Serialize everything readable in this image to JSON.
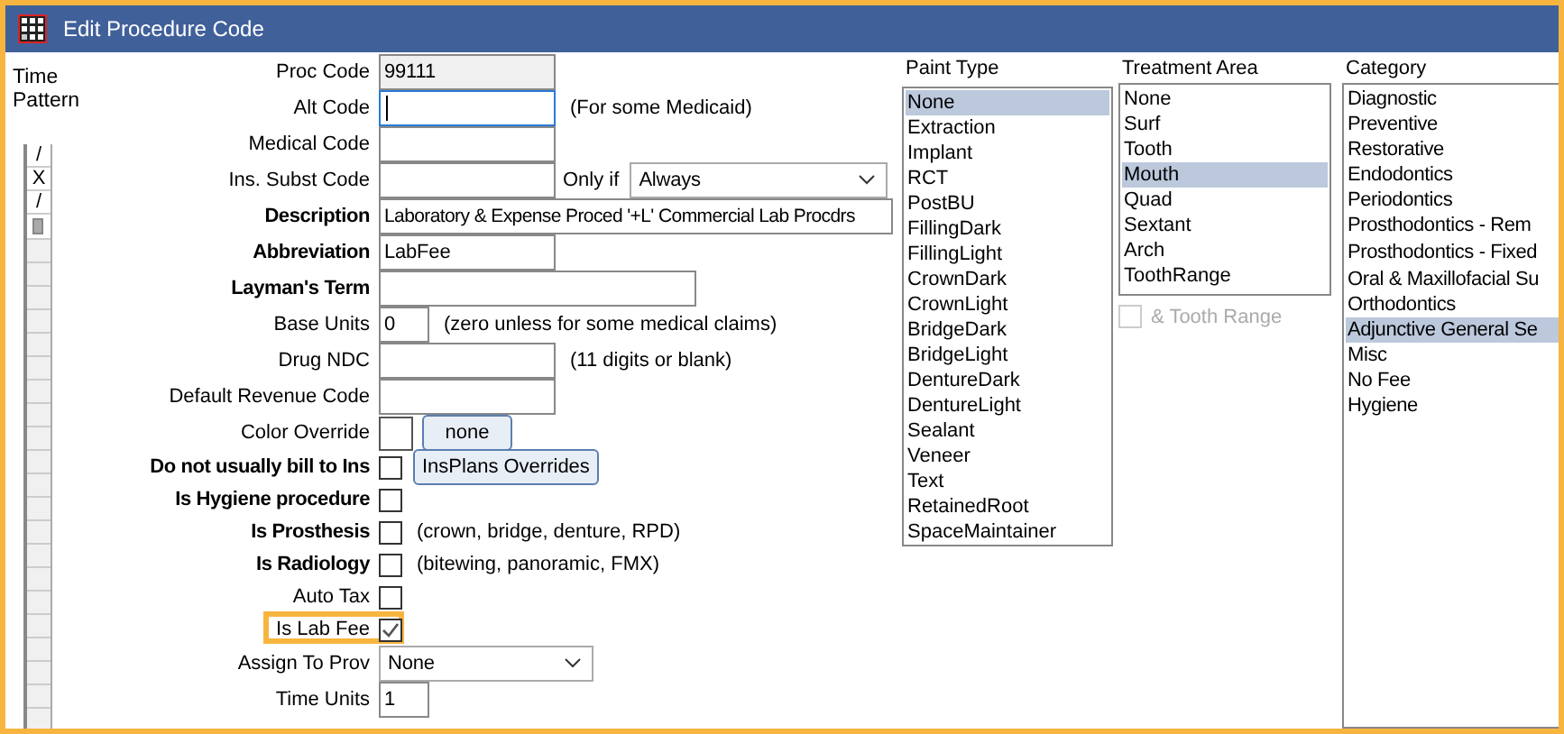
{
  "window": {
    "title": "Edit Procedure Code"
  },
  "time_pattern": {
    "label": "Time Pattern",
    "cells": [
      "/",
      "X",
      "/"
    ]
  },
  "form": [
    {
      "kind": "text",
      "label": "Proc Code",
      "value": "99111",
      "readonly": true
    },
    {
      "kind": "text",
      "label": "Alt Code",
      "focused": true,
      "note": "(For some Medicaid)"
    },
    {
      "kind": "text",
      "label": "Medical Code"
    },
    {
      "kind": "text",
      "label": "Ins. Subst Code",
      "extra_label": "Only if",
      "extra_value": "Always"
    },
    {
      "kind": "text",
      "label": "Description",
      "bold": true,
      "value": "Laboratory & Expense Proced '+L' Commercial Lab Procdrs"
    },
    {
      "kind": "text",
      "label": "Abbreviation",
      "bold": true,
      "value": "LabFee"
    },
    {
      "kind": "text",
      "label": "Layman's Term",
      "bold": true
    },
    {
      "kind": "text",
      "label": "Base Units",
      "value": "0",
      "note": "(zero unless for some medical claims)"
    },
    {
      "kind": "text",
      "label": "Drug NDC",
      "note": "(11 digits or blank)"
    },
    {
      "kind": "text",
      "label": "Default Revenue Code"
    },
    {
      "kind": "color",
      "label": "Color Override",
      "button": "none"
    },
    {
      "kind": "checkbox",
      "label": "Do not usually bill to Ins",
      "bold": true,
      "checked": false,
      "button": "InsPlans Overrides"
    },
    {
      "kind": "checkbox",
      "label": "Is Hygiene procedure",
      "bold": true,
      "checked": false
    },
    {
      "kind": "checkbox",
      "label": "Is Prosthesis",
      "bold": true,
      "checked": false,
      "note": "(crown, bridge, denture, RPD)"
    },
    {
      "kind": "checkbox",
      "label": "Is Radiology",
      "bold": true,
      "checked": false,
      "note": "(bitewing, panoramic, FMX)"
    },
    {
      "kind": "checkbox",
      "label": "Auto Tax",
      "checked": false
    },
    {
      "kind": "checkbox",
      "label": "Is Lab Fee",
      "checked": true,
      "highlighted": true
    },
    {
      "kind": "dropdown",
      "label": "Assign To Prov",
      "value": "None"
    },
    {
      "kind": "text",
      "label": "Time Units",
      "value": "1"
    }
  ],
  "lists": [
    {
      "title": "Paint Type",
      "items": [
        {
          "label": "None",
          "selected": true
        },
        {
          "label": "Extraction",
          "selected": false
        },
        {
          "label": "Implant",
          "selected": false
        },
        {
          "label": "RCT",
          "selected": false
        },
        {
          "label": "PostBU",
          "selected": false
        },
        {
          "label": "FillingDark",
          "selected": false
        },
        {
          "label": "FillingLight",
          "selected": false
        },
        {
          "label": "CrownDark",
          "selected": false
        },
        {
          "label": "CrownLight",
          "selected": false
        },
        {
          "label": "BridgeDark",
          "selected": false
        },
        {
          "label": "BridgeLight",
          "selected": false
        },
        {
          "label": "DentureDark",
          "selected": false
        },
        {
          "label": "DentureLight",
          "selected": false
        },
        {
          "label": "Sealant",
          "selected": false
        },
        {
          "label": "Veneer",
          "selected": false
        },
        {
          "label": "Text",
          "selected": false
        },
        {
          "label": "RetainedRoot",
          "selected": false
        },
        {
          "label": "SpaceMaintainer",
          "selected": false
        }
      ]
    },
    {
      "title": "Treatment Area",
      "items": [
        {
          "label": "None",
          "selected": false
        },
        {
          "label": "Surf",
          "selected": false
        },
        {
          "label": "Tooth",
          "selected": false
        },
        {
          "label": "Mouth",
          "selected": true
        },
        {
          "label": "Quad",
          "selected": false
        },
        {
          "label": "Sextant",
          "selected": false
        },
        {
          "label": "Arch",
          "selected": false
        },
        {
          "label": "ToothRange",
          "selected": false
        }
      ],
      "option": {
        "label": "& Tooth Range",
        "checked": false,
        "disabled": true
      }
    },
    {
      "title": "Category",
      "items": [
        {
          "label": "Diagnostic",
          "selected": false
        },
        {
          "label": "Preventive",
          "selected": false
        },
        {
          "label": "Restorative",
          "selected": false
        },
        {
          "label": "Endodontics",
          "selected": false
        },
        {
          "label": "Periodontics",
          "selected": false
        },
        {
          "label": "Prosthodontics - Rem",
          "selected": false
        },
        {
          "label": "Prosthodontics - Fixed",
          "selected": false
        },
        {
          "label": "Oral & Maxillofacial Su",
          "selected": false
        },
        {
          "label": "Orthodontics",
          "selected": false
        },
        {
          "label": "Adjunctive General Se",
          "selected": true
        },
        {
          "label": "Misc",
          "selected": false
        },
        {
          "label": "No Fee",
          "selected": false
        },
        {
          "label": "Hygiene",
          "selected": false
        }
      ]
    }
  ]
}
